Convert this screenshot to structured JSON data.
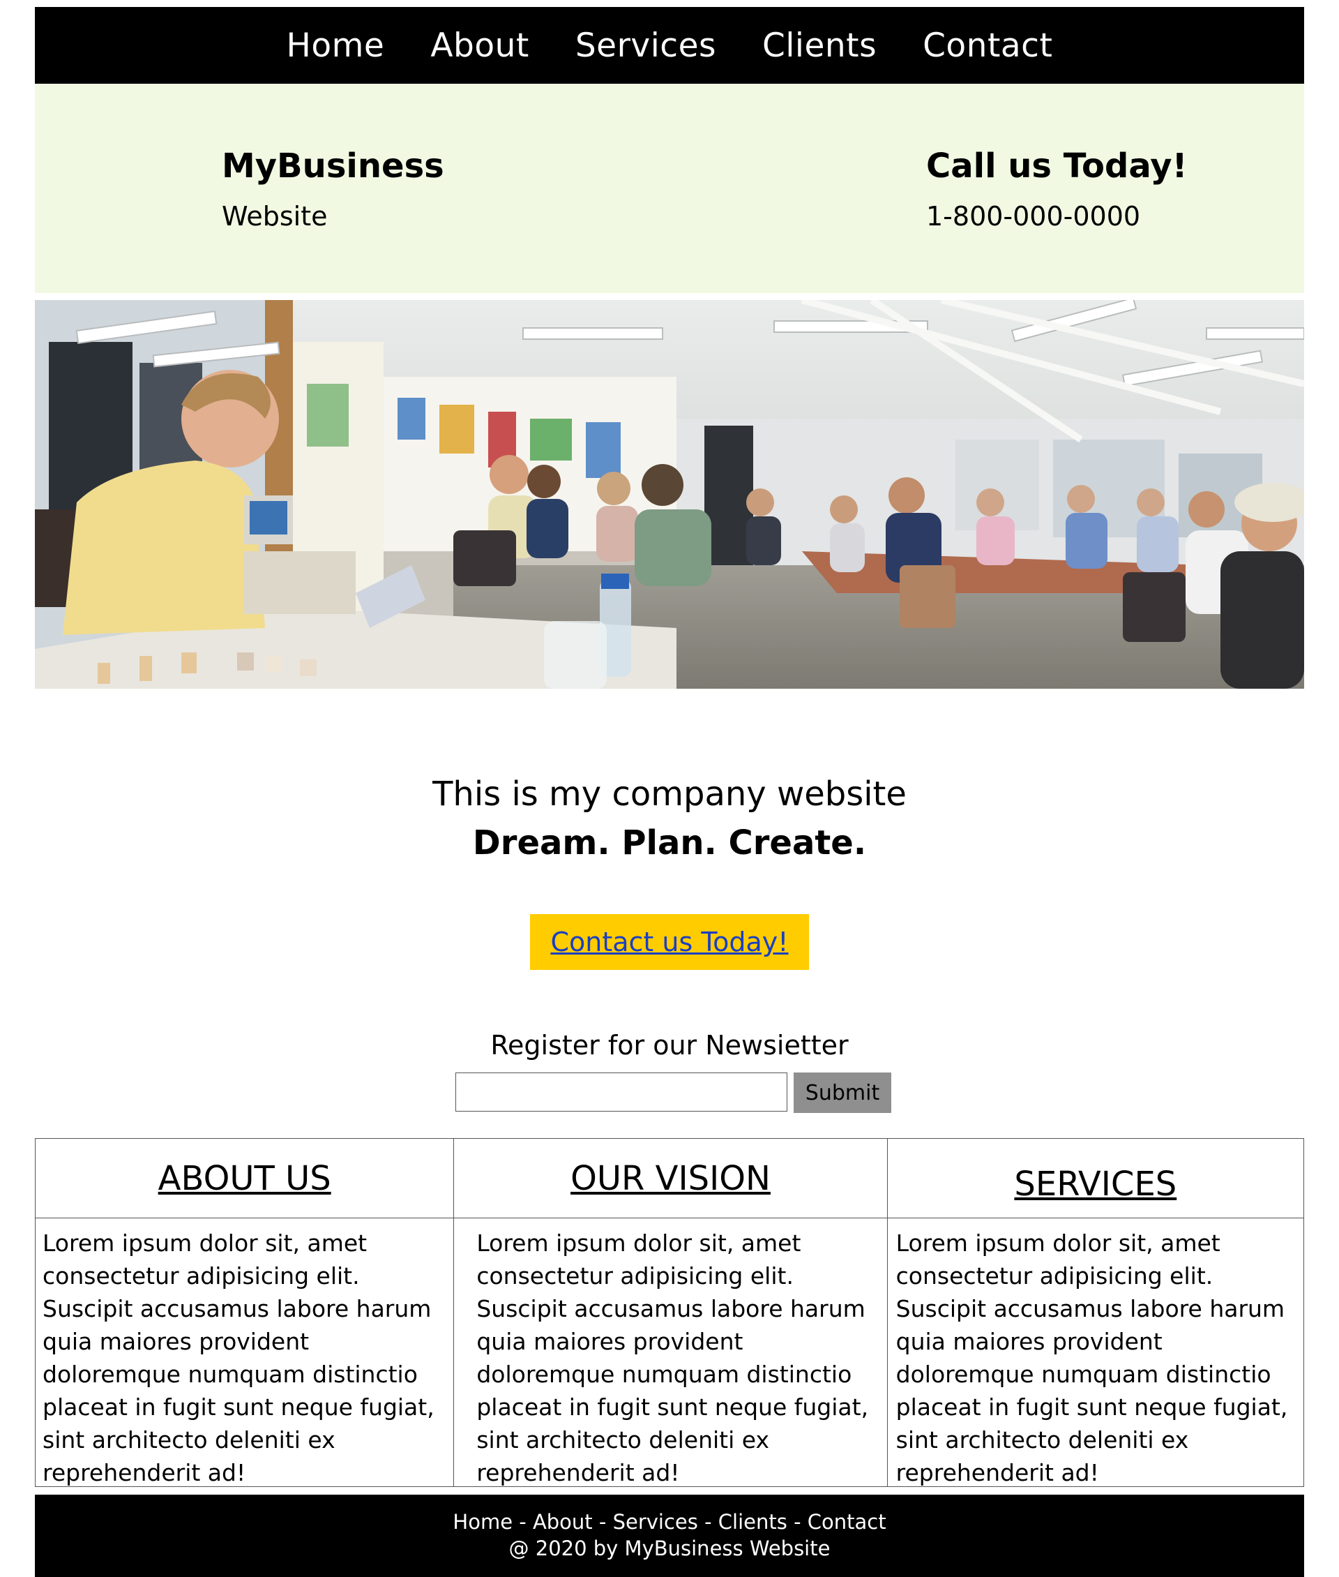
{
  "nav": {
    "items": [
      "Home",
      "About",
      "Services",
      "Clients",
      "Contact"
    ]
  },
  "header": {
    "brand_name": "MyBusiness",
    "brand_sub": "Website",
    "call_title": "Call us Today!",
    "phone": "1-800-000-0000"
  },
  "tagline": {
    "line1": "This is my company website",
    "line2": "Dream. Plan. Create."
  },
  "cta": {
    "label": "Contact us Today!",
    "bg": "#ffcc00"
  },
  "newsletter": {
    "label": "Register for our Newsietter",
    "input_value": "",
    "submit_label": "Submit"
  },
  "columns": [
    {
      "title": "ABOUT US",
      "text": "Lorem ipsum dolor sit, amet consectetur adipisicing elit. Suscipit accusamus labore harum quia maiores provident doloremque numquam distinctio placeat in fugit sunt neque fugiat, sint architecto deleniti ex reprehenderit ad!"
    },
    {
      "title": "OUR VISION",
      "text": "Lorem ipsum dolor sit, amet consectetur adipisicing elit. Suscipit accusamus labore harum quia maiores provident doloremque numquam distinctio placeat in fugit sunt neque fugiat, sint architecto deleniti ex reprehenderit ad!"
    },
    {
      "title": "SERVICES",
      "text": "Lorem ipsum dolor sit, amet consectetur adipisicing elit. Suscipit accusamus labore harum quia maiores provident doloremque numquam distinctio placeat in fugit sunt neque fugiat, sint architecto deleniti ex reprehenderit ad!"
    }
  ],
  "footer": {
    "links": [
      "Home",
      "About",
      "Services",
      "Clients",
      "Contact"
    ],
    "separator": " - ",
    "copyright": "@ 2020 by MyBusiness Website"
  }
}
